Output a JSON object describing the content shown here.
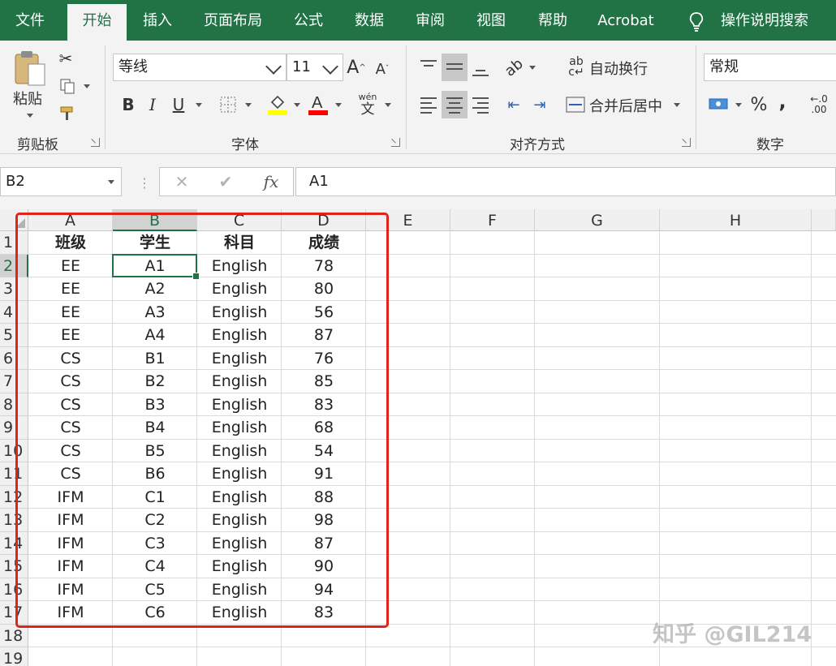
{
  "tabs": [
    "文件",
    "开始",
    "插入",
    "页面布局",
    "公式",
    "数据",
    "审阅",
    "视图",
    "帮助",
    "Acrobat",
    "操作说明搜索"
  ],
  "active_tab": "开始",
  "ribbon": {
    "clipboard": {
      "paste_label": "粘贴",
      "group_label": "剪贴板"
    },
    "font": {
      "font_name": "等线",
      "font_size": "11",
      "bold": "B",
      "italic": "I",
      "underline": "U",
      "phonetic": "wén",
      "phonetic_char": "文",
      "group_label": "字体",
      "fill_color": "#ffff00",
      "font_color": "#ff0000"
    },
    "alignment": {
      "wrap_text": "自动换行",
      "merge_center": "合并后居中",
      "group_label": "对齐方式"
    },
    "number": {
      "format": "常规",
      "percent": "%",
      "comma": ",",
      "decimal_top": "←.0",
      "decimal_bottom": ".00",
      "group_label": "数字"
    }
  },
  "formula_bar": {
    "name_box": "B2",
    "fx": "fx",
    "content": "A1"
  },
  "columns": [
    "A",
    "B",
    "C",
    "D",
    "E",
    "F",
    "G",
    "H"
  ],
  "selected_column": "B",
  "rows": [
    "1",
    "2",
    "3",
    "4",
    "5",
    "6",
    "7",
    "8",
    "9",
    "10",
    "11",
    "12",
    "13",
    "14",
    "15",
    "16",
    "17",
    "18",
    "19"
  ],
  "selected_row": "2",
  "table": {
    "headers": [
      "班级",
      "学生",
      "科目",
      "成绩"
    ],
    "rows": [
      [
        "EE",
        "A1",
        "English",
        "78"
      ],
      [
        "EE",
        "A2",
        "English",
        "80"
      ],
      [
        "EE",
        "A3",
        "English",
        "56"
      ],
      [
        "EE",
        "A4",
        "English",
        "87"
      ],
      [
        "CS",
        "B1",
        "English",
        "76"
      ],
      [
        "CS",
        "B2",
        "English",
        "85"
      ],
      [
        "CS",
        "B3",
        "English",
        "83"
      ],
      [
        "CS",
        "B4",
        "English",
        "68"
      ],
      [
        "CS",
        "B5",
        "English",
        "54"
      ],
      [
        "CS",
        "B6",
        "English",
        "91"
      ],
      [
        "IFM",
        "C1",
        "English",
        "88"
      ],
      [
        "IFM",
        "C2",
        "English",
        "98"
      ],
      [
        "IFM",
        "C3",
        "English",
        "87"
      ],
      [
        "IFM",
        "C4",
        "English",
        "90"
      ],
      [
        "IFM",
        "C5",
        "English",
        "94"
      ],
      [
        "IFM",
        "C6",
        "English",
        "83"
      ]
    ]
  },
  "annotation_color": "#e2231a",
  "watermark": "知乎 @GIL214",
  "accent_color": "#217346"
}
